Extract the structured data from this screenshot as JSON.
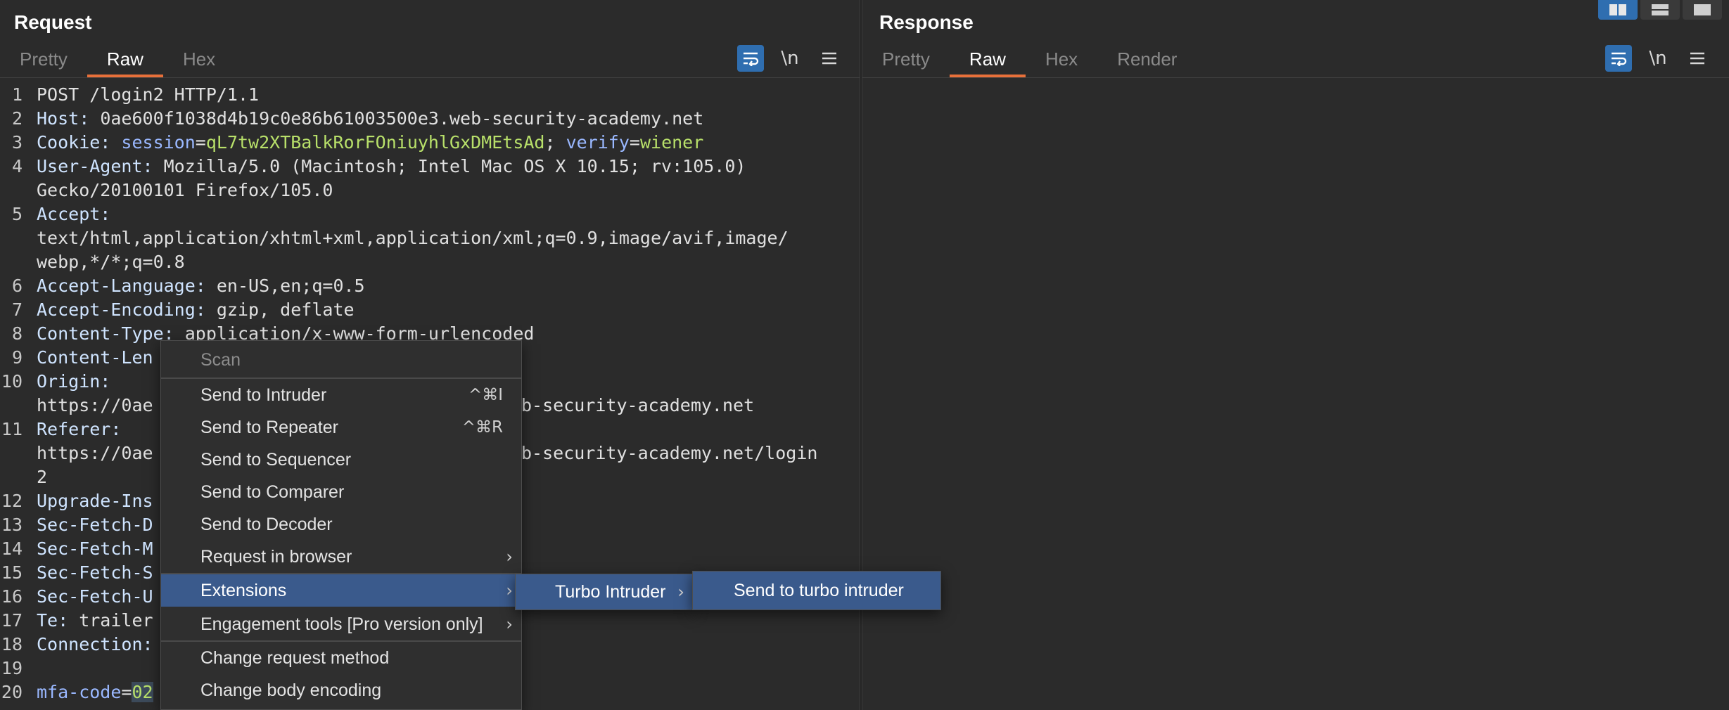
{
  "layout_buttons": [
    "split-vertical-icon",
    "split-horizontal-icon",
    "single-pane-icon"
  ],
  "request": {
    "title": "Request",
    "tabs": [
      {
        "label": "Pretty",
        "active": false
      },
      {
        "label": "Raw",
        "active": true
      },
      {
        "label": "Hex",
        "active": false
      }
    ],
    "tools": {
      "wrap_icon": "wrap-lines-icon",
      "newline_label": "\\n",
      "menu_icon": "hamburger-menu-icon"
    },
    "lines": {
      "l1": {
        "n": "1",
        "text": "POST /login2 HTTP/1.1"
      },
      "l2": {
        "n": "2",
        "key": "Host:",
        "value": " 0ae600f1038d4b19c0e86b61003500e3.web-security-academy.net"
      },
      "l3": {
        "n": "3",
        "key": "Cookie:",
        "c1k": " session",
        "c1v": "qL7tw2XTBalkRorFOniuyhlGxDMEtsAd",
        "sep": "; ",
        "c2k": "verify",
        "c2v": "wiener"
      },
      "l4": {
        "n": "4",
        "key": "User-Agent:",
        "value": " Mozilla/5.0 (Macintosh; Intel Mac OS X 10.15; rv:105.0)"
      },
      "l4b": {
        "text": "Gecko/20100101 Firefox/105.0"
      },
      "l5": {
        "n": "5",
        "key": "Accept:"
      },
      "l5b": {
        "text": "text/html,application/xhtml+xml,application/xml;q=0.9,image/avif,image/"
      },
      "l5c": {
        "text": "webp,*/*;q=0.8"
      },
      "l6": {
        "n": "6",
        "key": "Accept-Language:",
        "value": " en-US,en;q=0.5"
      },
      "l7": {
        "n": "7",
        "key": "Accept-Encoding:",
        "value": " gzip, deflate"
      },
      "l8": {
        "n": "8",
        "key": "Content-Type:",
        "value": " application/x-www-form-urlencoded"
      },
      "l9": {
        "n": "9",
        "key": "Content-Len"
      },
      "l10": {
        "n": "10",
        "key": "Origin:"
      },
      "l10b": {
        "left": "https://0ae",
        "right": "b-security-academy.net"
      },
      "l11": {
        "n": "11",
        "key": "Referer:"
      },
      "l11b": {
        "left": "https://0ae",
        "right": "b-security-academy.net/login"
      },
      "l11c": {
        "text": "2"
      },
      "l12": {
        "n": "12",
        "key": "Upgrade-Ins"
      },
      "l13": {
        "n": "13",
        "key": "Sec-Fetch-D"
      },
      "l14": {
        "n": "14",
        "key": "Sec-Fetch-M"
      },
      "l15": {
        "n": "15",
        "key": "Sec-Fetch-S"
      },
      "l16": {
        "n": "16",
        "key": "Sec-Fetch-U"
      },
      "l17": {
        "n": "17",
        "key": "Te:",
        "value": " trailer"
      },
      "l18": {
        "n": "18",
        "key": "Connection:"
      },
      "l19": {
        "n": "19"
      },
      "l20": {
        "n": "20",
        "key": "mfa-code",
        "eq": "=",
        "value": "02"
      }
    }
  },
  "response": {
    "title": "Response",
    "tabs": [
      {
        "label": "Pretty",
        "active": false
      },
      {
        "label": "Raw",
        "active": true
      },
      {
        "label": "Hex",
        "active": false
      },
      {
        "label": "Render",
        "active": false
      }
    ],
    "tools": {
      "wrap_icon": "wrap-lines-icon",
      "newline_label": "\\n",
      "menu_icon": "hamburger-menu-icon"
    }
  },
  "context_menu": {
    "scan": "Scan",
    "send_to_intruder": {
      "label": "Send to Intruder",
      "shortcut": "^⌘I"
    },
    "send_to_repeater": {
      "label": "Send to Repeater",
      "shortcut": "^⌘R"
    },
    "send_to_sequencer": "Send to Sequencer",
    "send_to_comparer": "Send to Comparer",
    "send_to_decoder": "Send to Decoder",
    "request_in_browser": "Request in browser",
    "extensions": "Extensions",
    "engagement_tools": "Engagement tools [Pro version only]",
    "change_request_method": "Change request method",
    "change_body_encoding": "Change body encoding",
    "submenu_arrow": "›"
  },
  "extensions_submenu": {
    "turbo_intruder": "Turbo Intruder"
  },
  "turbo_submenu": {
    "send_to_turbo_intruder": "Send to turbo intruder"
  }
}
